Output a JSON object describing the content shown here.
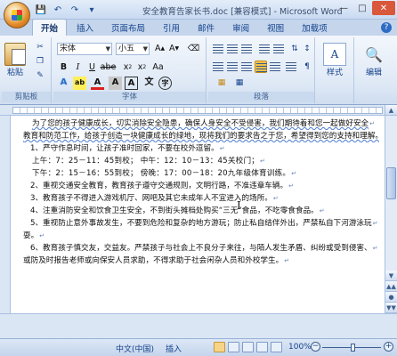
{
  "window": {
    "title": "安全教育告家长书.doc [兼容模式] - Microsoft Word"
  },
  "quick_access": [
    "save-icon",
    "undo-icon",
    "redo-icon",
    "customize-icon"
  ],
  "tabs": [
    {
      "label": "开始",
      "active": true
    },
    {
      "label": "插入"
    },
    {
      "label": "页面布局"
    },
    {
      "label": "引用"
    },
    {
      "label": "邮件"
    },
    {
      "label": "审阅"
    },
    {
      "label": "视图"
    },
    {
      "label": "加载项"
    }
  ],
  "ribbon": {
    "clipboard": {
      "paste_label": "粘贴",
      "group_label": "剪贴板"
    },
    "font": {
      "font_name": "宋体",
      "font_size": "小五",
      "group_label": "字体"
    },
    "paragraph": {
      "group_label": "段落"
    },
    "styles": {
      "label": "样式"
    },
    "editing": {
      "label": "编辑"
    }
  },
  "document": {
    "lines": [
      {
        "text": "为了您的孩子健康成长，切实消除安全隐患，确保人身安全不受侵害，我们期待着和您一起做好安全",
        "cls": "para-first",
        "wavy": true
      },
      {
        "text": "教育和防范工作，给孩子创造一块健康成长的绿地，现将我们的要求告之于您，希望得到您的支持和理解。",
        "cls": "",
        "wavy": true
      },
      {
        "text": "1、严守作息时间，让孩子准时回家，不要在校外逗留。",
        "cls": "item"
      },
      {
        "text": "上午：7：25－11：45到校；  中午：12：10－13：45关校门；",
        "cls": "time"
      },
      {
        "text": "下午：2：15－16：55到校；  傍晚：17：00－18：20九年级体育训练。",
        "cls": "time"
      },
      {
        "text": "2、重视交通安全教育，教育孩子遵守交通规则，文明行路，不准违章车辆。",
        "cls": "item"
      },
      {
        "text": "3、教育孩子不得进入游戏机厅、网吧及其它未成年人不宜进入的场所。",
        "cls": "item"
      },
      {
        "text": "4、注重消防安全和饮食卫生安全，不到街头摊档处购买“三无”食品，不吃零食食品。",
        "cls": "item"
      },
      {
        "text": "5、重视防止意外事故发生，不要到危险和复杂的地方游玩；防止私自结伴外出，严禁私自下河游泳玩",
        "cls": "item"
      },
      {
        "text": "耍。",
        "cls": ""
      },
      {
        "text": "6、教育孩子慎交友，交益友。严禁孩子与社会上不良分子来往，与陌人发生矛盾、纠纷或受到侵害、",
        "cls": "item"
      },
      {
        "text": "或防及时报告老师或向保安人员求助，不得求助于社会闲杂人员和外校学生。",
        "cls": ""
      }
    ]
  },
  "statusbar": {
    "language": "中文(中国)",
    "mode": "插入",
    "zoom": "100%"
  }
}
